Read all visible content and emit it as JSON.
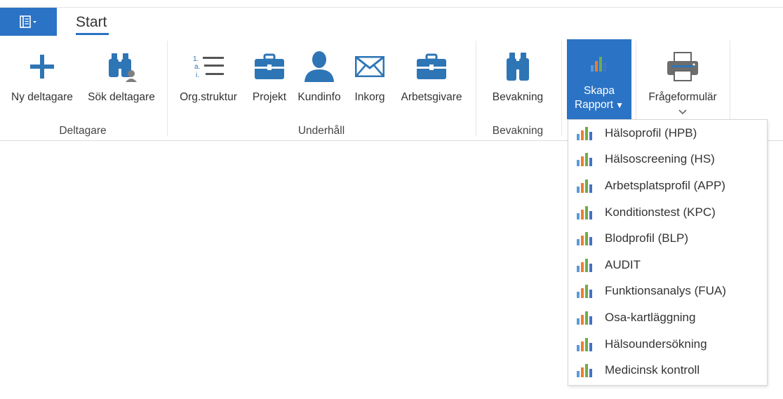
{
  "tabs": {
    "active": "Start"
  },
  "ribbon": {
    "ny_deltagare": "Ny deltagare",
    "sok_deltagare": "Sök deltagare",
    "org_struktur": "Org.struktur",
    "projekt": "Projekt",
    "kundinfo": "Kundinfo",
    "inkorg": "Inkorg",
    "arbetsgivare": "Arbetsgivare",
    "bevakning": "Bevakning",
    "skapa_line1": "Skapa",
    "skapa_line2": "Rapport",
    "frageformular": "Frågeformulär"
  },
  "groups": {
    "deltagare": "Deltagare",
    "underhall": "Underhåll",
    "bevakning": "Bevakning"
  },
  "report_menu": {
    "items": [
      "Hälsoprofil (HPB)",
      "Hälsoscreening (HS)",
      "Arbetsplatsprofil (APP)",
      "Konditionstest (KPC)",
      "Blodprofil (BLP)",
      "AUDIT",
      "Funktionsanalys (FUA)",
      "Osa-kartläggning",
      "Hälsoundersökning",
      "Medicinsk kontroll"
    ]
  },
  "colors": {
    "accent": "#2b73c4",
    "icon_blue": "#2e75b6"
  },
  "icons": {
    "app_menu": "menu-book-icon",
    "ny_deltagare": "plus-icon",
    "sok_deltagare": "binoculars-person-icon",
    "org_struktur": "numbered-list-icon",
    "projekt": "briefcase-icon",
    "kundinfo": "person-icon",
    "inkorg": "envelope-icon",
    "arbetsgivare": "briefcase-icon",
    "bevakning": "binoculars-icon",
    "skapa_rapport": "bar-chart-icon",
    "frageformular": "printer-icon"
  }
}
